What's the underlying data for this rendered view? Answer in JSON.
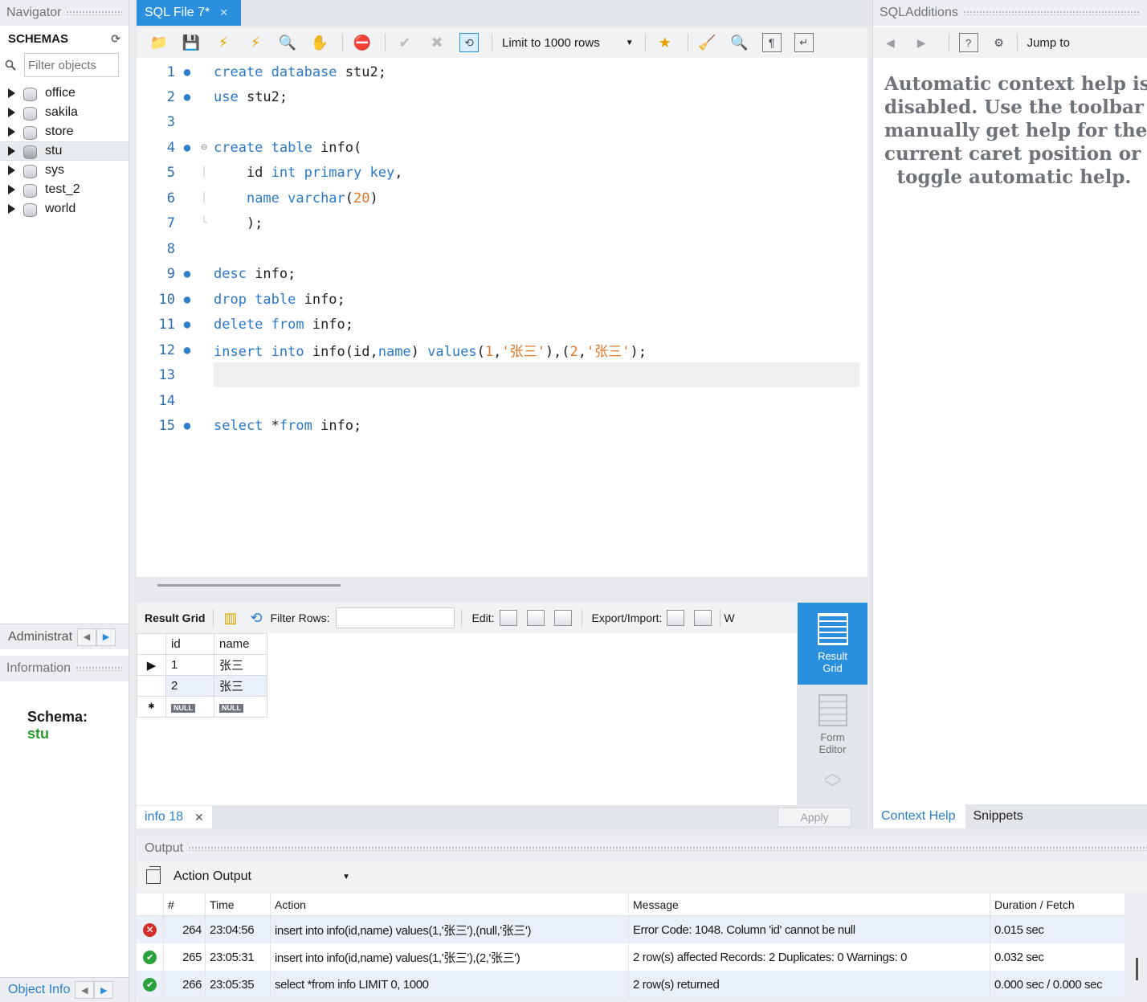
{
  "navigator": {
    "title": "Navigator",
    "schemas_label": "SCHEMAS",
    "filter_placeholder": "Filter objects",
    "schemas": [
      "office",
      "sakila",
      "store",
      "stu",
      "sys",
      "test_2",
      "world"
    ],
    "selected_schema": "stu",
    "admin_tab": "Administrat",
    "information_title": "Information",
    "schema_label": "Schema:",
    "schema_value": "stu",
    "object_info_tab": "Object Info"
  },
  "editor": {
    "tab_title": "SQL File 7*",
    "limit_label": "Limit to 1000 rows",
    "lines": [
      {
        "n": "1",
        "dot": true
      },
      {
        "n": "2",
        "dot": true
      },
      {
        "n": "3",
        "dot": false
      },
      {
        "n": "4",
        "dot": true
      },
      {
        "n": "5",
        "dot": false
      },
      {
        "n": "6",
        "dot": false
      },
      {
        "n": "7",
        "dot": false
      },
      {
        "n": "8",
        "dot": false
      },
      {
        "n": "9",
        "dot": true
      },
      {
        "n": "10",
        "dot": true
      },
      {
        "n": "11",
        "dot": true
      },
      {
        "n": "12",
        "dot": true
      },
      {
        "n": "13",
        "dot": false
      },
      {
        "n": "14",
        "dot": false
      },
      {
        "n": "15",
        "dot": true
      }
    ],
    "code": {
      "l1_kw": "create database",
      "l1_rest": " stu2;",
      "l2_kw": "use",
      "l2_rest": " stu2;",
      "l4_kw": "create table",
      "l4_rest": " info(",
      "l5_a": "    id ",
      "l5_kw": "int primary key",
      "l5_b": ",",
      "l6_a": "    ",
      "l6_kw1": "name varchar",
      "l6_p1": "(",
      "l6_num": "20",
      "l6_p2": ")",
      "l7": "    );",
      "l9_kw": "desc",
      "l9_rest": " info;",
      "l10_kw": "drop table",
      "l10_rest": " info;",
      "l11_kw": "delete from",
      "l11_rest": " info;",
      "l12_kw": "insert into",
      "l12_a": " info(id,",
      "l12_kw2": "name",
      "l12_b": ") ",
      "l12_kw3": "values",
      "l12_c": "(",
      "l12_n1": "1",
      "l12_d": ",",
      "l12_s1": "'张三'",
      "l12_e": "),(",
      "l12_n2": "2",
      "l12_f": ",",
      "l12_s2": "'张三'",
      "l12_g": ");",
      "l15_kw": "select",
      "l15_a": " *",
      "l15_kw2": "from",
      "l15_rest": " info;"
    }
  },
  "result": {
    "grid_label": "Result Grid",
    "filter_label": "Filter Rows:",
    "edit_label": "Edit:",
    "export_label": "Export/Import:",
    "wrap_label": "W",
    "columns": [
      "id",
      "name"
    ],
    "rows": [
      {
        "id": "1",
        "name": "张三"
      },
      {
        "id": "2",
        "name": "张三"
      }
    ],
    "null_badge": "NULL",
    "side_active": "Result\nGrid",
    "side_form": "Form\nEditor",
    "tab_label": "info 18",
    "apply_label": "Apply"
  },
  "sql_additions": {
    "title": "SQLAdditions",
    "jump_label": "Jump to",
    "help_lines": [
      "Automatic context help is",
      "disabled. Use the toolbar t",
      "manually get help for the",
      "current caret position or to",
      "toggle automatic help."
    ],
    "tab_context": "Context Help",
    "tab_snippets": "Snippets"
  },
  "output": {
    "title": "Output",
    "selector": "Action Output",
    "headers": [
      "#",
      "Time",
      "Action",
      "Message",
      "Duration / Fetch"
    ],
    "rows": [
      {
        "status": "error",
        "n": "264",
        "time": "23:04:56",
        "action": "insert into info(id,name) values(1,'张三'),(null,'张三')",
        "message": "Error Code: 1048. Column 'id' cannot be null",
        "duration": "0.015 sec"
      },
      {
        "status": "ok",
        "n": "265",
        "time": "23:05:31",
        "action": "insert into info(id,name) values(1,'张三'),(2,'张三')",
        "message": "2 row(s) affected Records: 2  Duplicates: 0  Warnings: 0",
        "duration": "0.032 sec"
      },
      {
        "status": "ok",
        "n": "266",
        "time": "23:05:35",
        "action": "select *from info LIMIT 0, 1000",
        "message": "2 row(s) returned",
        "duration": "0.000 sec / 0.000 sec"
      }
    ]
  },
  "colors": {
    "accent": "#2a8fdc",
    "keyword": "#2878c8",
    "literal": "#e0762a",
    "error": "#d42f2f",
    "ok": "#2aa33c"
  }
}
